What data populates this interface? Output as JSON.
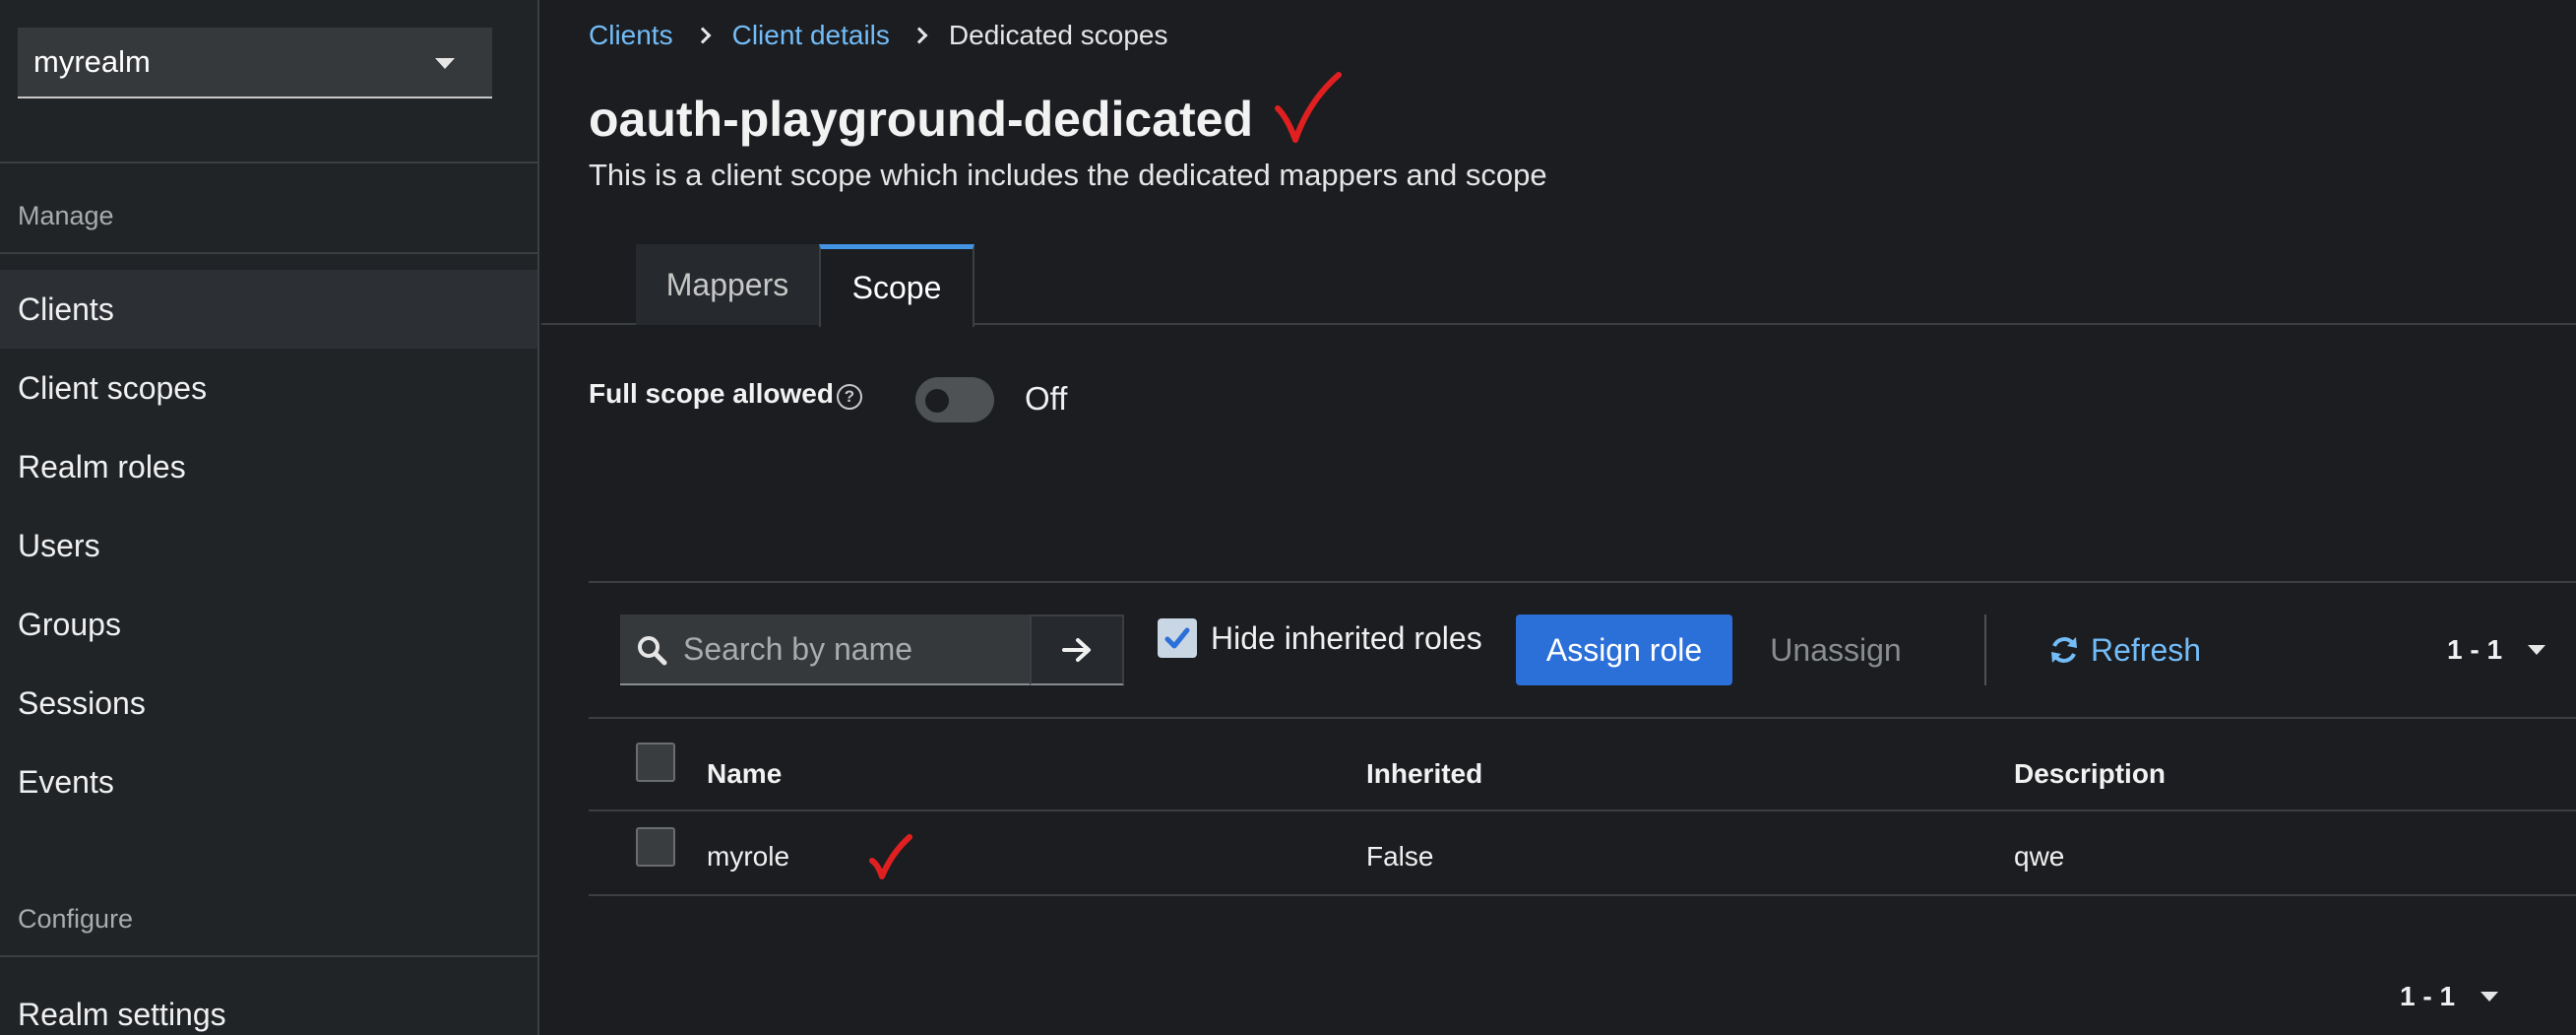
{
  "sidebar": {
    "realm": "myrealm",
    "sections": {
      "manage": "Manage",
      "configure": "Configure"
    },
    "items": [
      {
        "label": "Clients",
        "active": true
      },
      {
        "label": "Client scopes"
      },
      {
        "label": "Realm roles"
      },
      {
        "label": "Users"
      },
      {
        "label": "Groups"
      },
      {
        "label": "Sessions"
      },
      {
        "label": "Events"
      }
    ],
    "configure_items": [
      {
        "label": "Realm settings"
      }
    ]
  },
  "breadcrumb": {
    "items": [
      "Clients",
      "Client details",
      "Dedicated scopes"
    ]
  },
  "header": {
    "title": "oauth-playground-dedicated",
    "subtitle": "This is a client scope which includes the dedicated mappers and scope"
  },
  "tabs": [
    {
      "label": "Mappers",
      "active": false
    },
    {
      "label": "Scope",
      "active": true
    }
  ],
  "full_scope": {
    "label": "Full scope allowed",
    "help_icon": "question-circle-icon",
    "state_label": "Off",
    "enabled": false
  },
  "toolbar": {
    "search_placeholder": "Search by name",
    "hide_inherited_label": "Hide inherited roles",
    "hide_inherited_checked": true,
    "assign_label": "Assign role",
    "unassign_label": "Unassign",
    "refresh_label": "Refresh",
    "pagination": "1 - 1"
  },
  "table": {
    "columns": [
      "Name",
      "Inherited",
      "Description"
    ],
    "rows": [
      {
        "name": "myrole",
        "inherited": "False",
        "description": "qwe"
      }
    ]
  },
  "footer": {
    "pagination": "1 - 1"
  },
  "colors": {
    "accent": "#2b6fd8",
    "link": "#73bcf7",
    "annotation": "#e02020"
  }
}
